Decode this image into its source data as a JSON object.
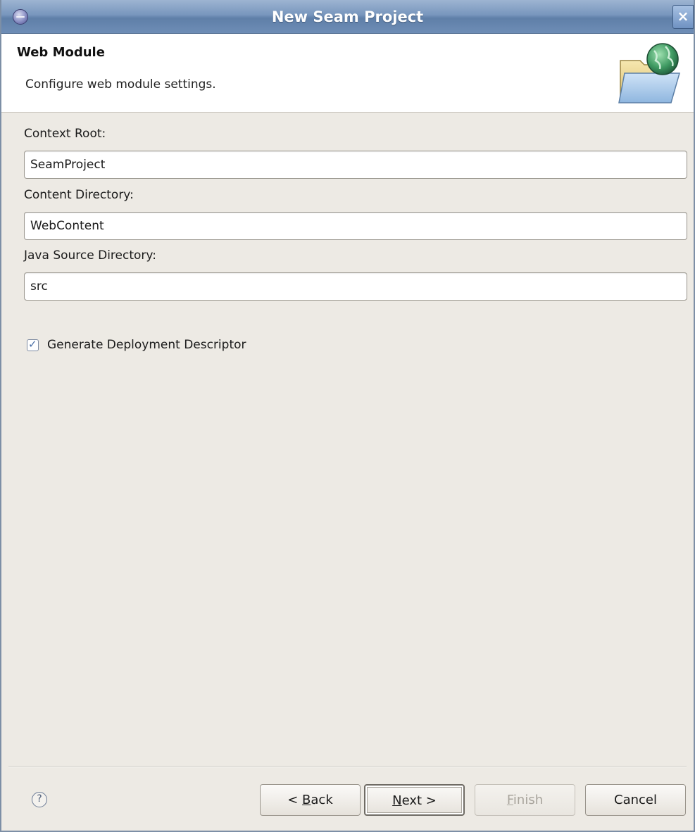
{
  "window": {
    "title": "New Seam Project",
    "close_glyph": "×"
  },
  "banner": {
    "title": "Web Module",
    "description": "Configure web module settings.",
    "icon": "folder-globe-icon"
  },
  "form": {
    "context_root": {
      "label": "Context Root:",
      "value": "SeamProject"
    },
    "content_directory": {
      "label": "Content Directory:",
      "value": "WebContent"
    },
    "java_source_directory": {
      "label": "Java Source Directory:",
      "value": "src"
    },
    "generate_descriptor": {
      "label": "Generate Deployment Descriptor",
      "checked": true
    }
  },
  "footer": {
    "help_glyph": "?",
    "back": {
      "prefix": "< ",
      "mnemonic": "B",
      "rest": "ack"
    },
    "next": {
      "mnemonic": "N",
      "rest": "ext >"
    },
    "finish": {
      "mnemonic": "F",
      "rest": "inish",
      "enabled": false
    },
    "cancel": {
      "label": "Cancel"
    }
  },
  "colors": {
    "titlebar": "#7896bd",
    "dialog_bg": "#edeae4",
    "banner_bg": "#ffffff"
  }
}
